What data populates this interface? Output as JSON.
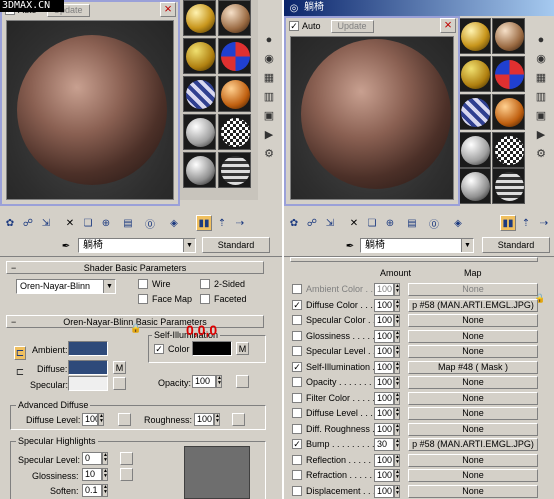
{
  "watermark": "3DMAX.CN",
  "left": {
    "preview": {
      "auto": "Auto",
      "update": "Update",
      "close": "×"
    },
    "material_name": "躺椅",
    "material_type": "Standard",
    "shader_title": "Shader Basic Parameters",
    "shader_type": "Oren-Nayar-Blinn",
    "shader_opts": {
      "wire": "Wire",
      "two_sided": "2-Sided",
      "face_map": "Face Map",
      "faceted": "Faceted"
    },
    "onb_title": "Oren-Nayar-Blinn Basic Parameters",
    "self_illum": {
      "group": "Self-Illumination",
      "color": "Color",
      "annotation": "0,0,0",
      "m": "M"
    },
    "ambient": "Ambient:",
    "diffuse": "Diffuse:",
    "specular": "Specular:",
    "m": "M",
    "opacity": {
      "label": "Opacity:",
      "value": "100"
    },
    "adv": {
      "group": "Advanced Diffuse",
      "diffuse_level": "Diffuse Level:",
      "diffuse_level_val": "100",
      "roughness": "Roughness:",
      "roughness_val": "100"
    },
    "spec": {
      "group": "Specular Highlights",
      "level": "Specular Level:",
      "level_val": "0",
      "gloss": "Glossiness:",
      "gloss_val": "10",
      "soften": "Soften:",
      "soften_val": "0.1"
    },
    "colors": {
      "ambient": "#2e4a7a",
      "diffuse": "#2e4a7a",
      "specular": "#efefef",
      "self_illum": "#000000",
      "annotation": "#e00000"
    }
  },
  "right": {
    "title": "躺椅",
    "preview": {
      "auto": "Auto",
      "update": "Update",
      "close": "×"
    },
    "material_name": "躺椅",
    "material_type": "Standard",
    "header": {
      "amount": "Amount",
      "map": "Map"
    },
    "maps": [
      {
        "label": "Ambient Color . . . .",
        "amount": "100",
        "map": "None",
        "checked": false,
        "dim": true
      },
      {
        "label": "Diffuse Color . . . .",
        "amount": "100",
        "map": "p #58 (MAN.ARTI.EMGL.JPG)",
        "checked": true,
        "dim": false
      },
      {
        "label": "Specular Color . . .",
        "amount": "100",
        "map": "None",
        "checked": false,
        "dim": false
      },
      {
        "label": "Glossiness . . . . . .",
        "amount": "100",
        "map": "None",
        "checked": false,
        "dim": false
      },
      {
        "label": "Specular Level . . .",
        "amount": "100",
        "map": "None",
        "checked": false,
        "dim": false
      },
      {
        "label": "Self-Illumination .",
        "amount": "100",
        "map": "Map #48 ( Mask )",
        "checked": true,
        "dim": false
      },
      {
        "label": "Opacity . . . . . . . .",
        "amount": "100",
        "map": "None",
        "checked": false,
        "dim": false
      },
      {
        "label": "Filter Color . . . . .",
        "amount": "100",
        "map": "None",
        "checked": false,
        "dim": false
      },
      {
        "label": "Diffuse Level . . . .",
        "amount": "100",
        "map": "None",
        "checked": false,
        "dim": false
      },
      {
        "label": "Diff. Roughness . .",
        "amount": "100",
        "map": "None",
        "checked": false,
        "dim": false
      },
      {
        "label": "Bump . . . . . . . . . .",
        "amount": "30",
        "map": "p #58 (MAN.ARTI.EMGL.JPG)",
        "checked": true,
        "dim": false
      },
      {
        "label": "Reflection . . . . . .",
        "amount": "100",
        "map": "None",
        "checked": false,
        "dim": false
      },
      {
        "label": "Refraction . . . . . .",
        "amount": "100",
        "map": "None",
        "checked": false,
        "dim": false
      },
      {
        "label": "Displacement . . . .",
        "amount": "100",
        "map": "None",
        "checked": false,
        "dim": false
      }
    ]
  }
}
